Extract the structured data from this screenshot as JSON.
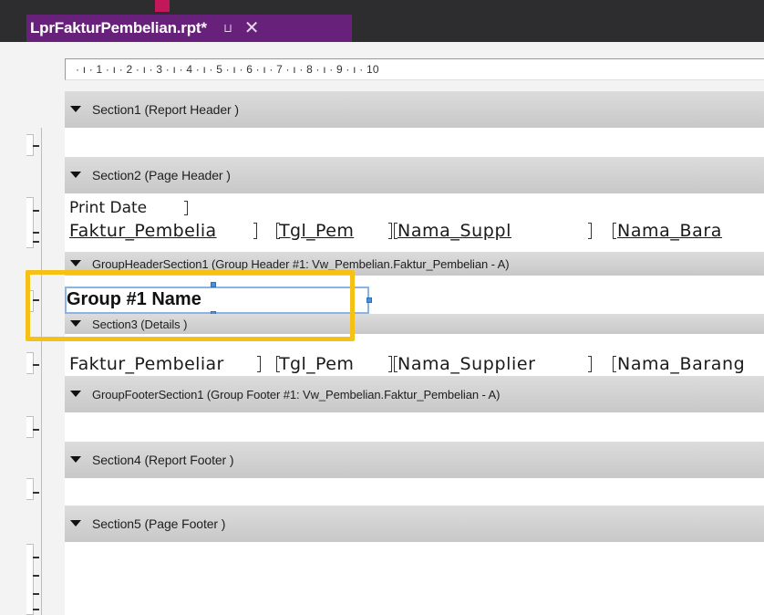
{
  "tab": {
    "title": "LprFakturPembelian.rpt*",
    "pin_glyph": "⊐",
    "close_glyph": "✕"
  },
  "ruler": {
    "text": "· ı · 1 · ı · 2 · ı · 3 · ı · 4 · ı · 5 · ı · 6 · ı · 7 · ı · 8 · ı · 9 · ı · 10"
  },
  "sections": {
    "report_header": "Section1 (Report Header )",
    "page_header": "Section2 (Page Header )",
    "group_header": "GroupHeaderSection1 (Group Header #1: Vw_Pembelian.Faktur_Pembelian - A)",
    "details": "Section3 (Details )",
    "group_footer": "GroupFooterSection1 (Group Footer #1: Vw_Pembelian.Faktur_Pembelian - A)",
    "report_footer": "Section4 (Report Footer )",
    "page_footer": "Section5 (Page Footer )"
  },
  "page_header_fields": {
    "print_date": "Print Date",
    "faktur": "Faktur_Pembelia",
    "tgl": "Tgl_Pem",
    "supplier": "Nama_Suppl",
    "barang": "Nama_Bara"
  },
  "group_name_field": "Group #1 Name",
  "details_fields": {
    "faktur": "Faktur_Pembeliar",
    "tgl": "Tgl_Pem",
    "supplier": "Nama_Supplier",
    "barang": "Nama_Barang"
  },
  "colors": {
    "tab_bg": "#68217a",
    "highlight": "#f5c116",
    "selection": "#4a90e2"
  }
}
